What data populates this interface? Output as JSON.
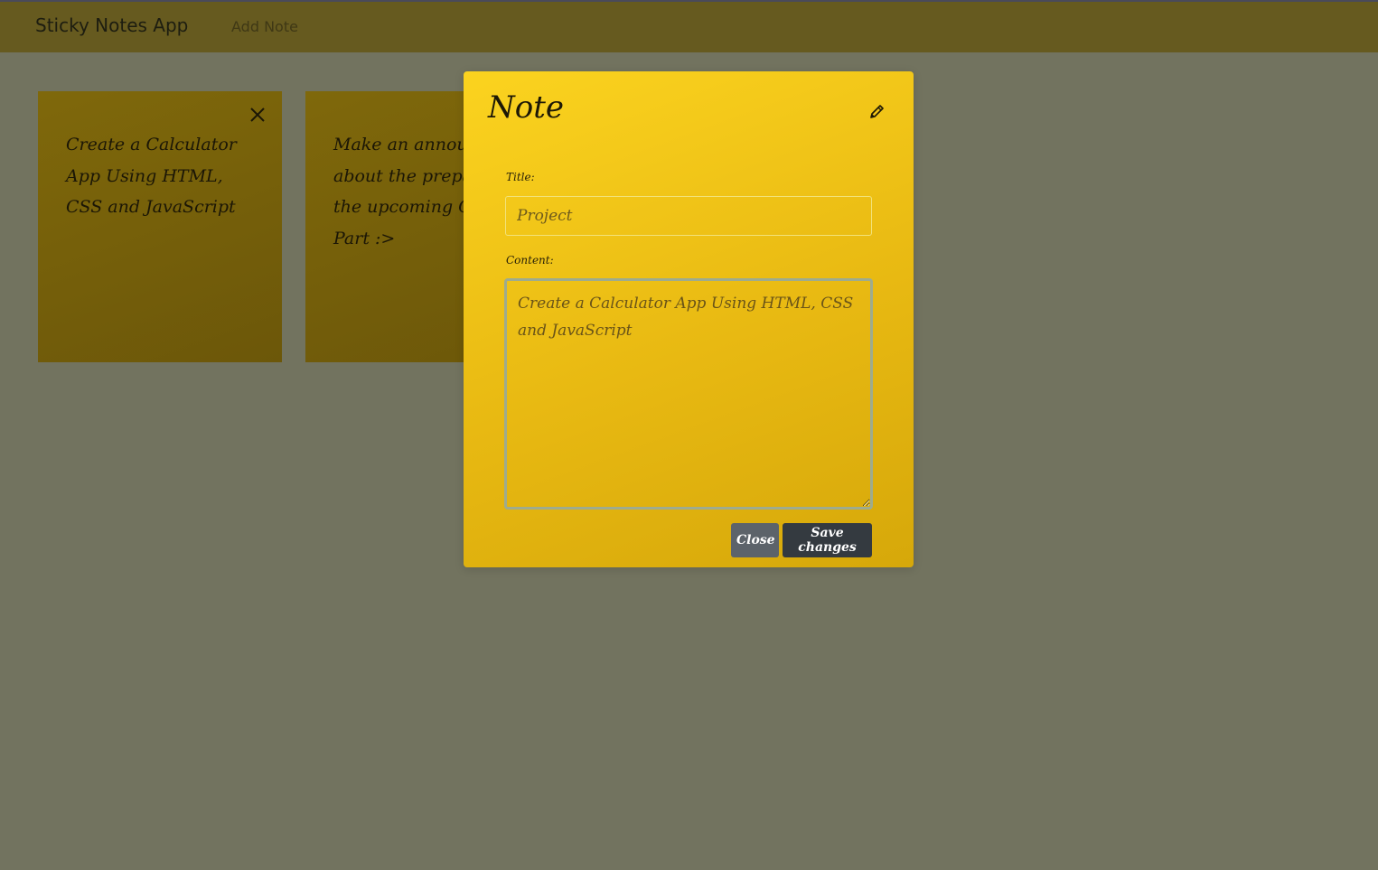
{
  "navbar": {
    "brand": "Sticky Notes App",
    "add_note_link": "Add Note"
  },
  "notes": [
    {
      "content": "Create a Calculator App Using HTML, CSS and JavaScript"
    },
    {
      "content": "Make an announc\nabout the prepara\nthe upcoming Chri\nPart :>"
    }
  ],
  "modal": {
    "title": "Note",
    "title_label": "Title:",
    "title_value": "Project",
    "content_label": "Content:",
    "content_value": "Create a Calculator App Using HTML, CSS and JavaScript",
    "close_label": "Close",
    "save_label": "Save changes"
  },
  "icons": {
    "delete_note": "close-icon",
    "edit_note": "pencil-icon"
  },
  "colors": {
    "overlay_bg": "#72735f",
    "navbar_bg": "#665a1f",
    "note_bg": "#7f680b",
    "modal_bg": "#fbd31f",
    "close_button": "#5c636a",
    "save_button": "#343a40"
  }
}
